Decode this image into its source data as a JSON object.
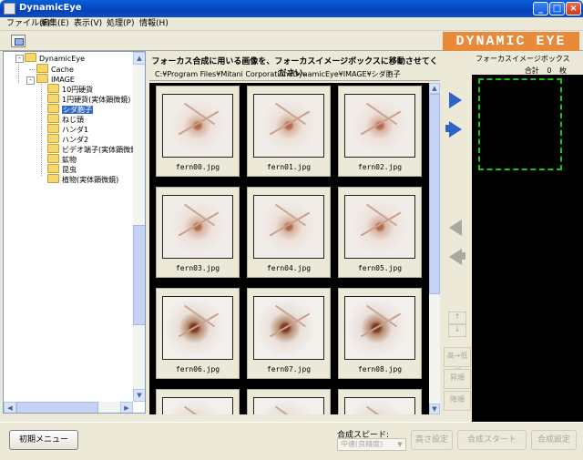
{
  "window": {
    "title": "DynamicEye"
  },
  "menu": [
    {
      "label": "ファイル(F)"
    },
    {
      "label": "編集(E)"
    },
    {
      "label": "表示(V)"
    },
    {
      "label": "処理(P)"
    },
    {
      "label": "情報(H)"
    }
  ],
  "logo": "DYNAMIC EYE",
  "tree": {
    "root": "DynamicEye",
    "items": [
      {
        "label": "Cache"
      },
      {
        "label": "IMAGE"
      },
      {
        "label": "10円硬貨"
      },
      {
        "label": "1円硬貨(実体顕微鏡)"
      },
      {
        "label": "シダ胞子",
        "selected": true
      },
      {
        "label": "ねじ頭"
      },
      {
        "label": "ハンダ1"
      },
      {
        "label": "ハンダ2"
      },
      {
        "label": "ビデオ端子(実体顕微鏡)"
      },
      {
        "label": "鉱物"
      },
      {
        "label": "昆虫"
      },
      {
        "label": "植物(実体顕微鏡)"
      }
    ]
  },
  "instruction": "フォーカス合成に用いる画像を、フォーカスイメージボックスに移動させてください。",
  "path": "C:¥Program Files¥Mitani Corporation¥DynamicEye¥IMAGE¥シダ胞子",
  "thumbnails": [
    {
      "label": "fern00.jpg"
    },
    {
      "label": "fern01.jpg"
    },
    {
      "label": "fern02.jpg"
    },
    {
      "label": "fern03.jpg"
    },
    {
      "label": "fern04.jpg"
    },
    {
      "label": "fern05.jpg"
    },
    {
      "label": "fern06.jpg"
    },
    {
      "label": "fern07.jpg"
    },
    {
      "label": "fern08.jpg"
    },
    {
      "label": ""
    },
    {
      "label": ""
    },
    {
      "label": ""
    }
  ],
  "focusbox": {
    "title": "フォーカスイメージボックス",
    "total_label": "合計",
    "total_value": "0",
    "total_unit": "枚"
  },
  "side_buttons": {
    "up": "↑",
    "down": "↓",
    "ascending": "高→低順",
    "sort": "昇順",
    "descending": "降順"
  },
  "bottom": {
    "init_menu": "初期メニュー",
    "speed_label": "合成スピード:",
    "speed_value": "中速(良精度)",
    "height_setting": "高さ設定",
    "compose_start": "合成スタート",
    "compose_setting": "合成設定"
  }
}
